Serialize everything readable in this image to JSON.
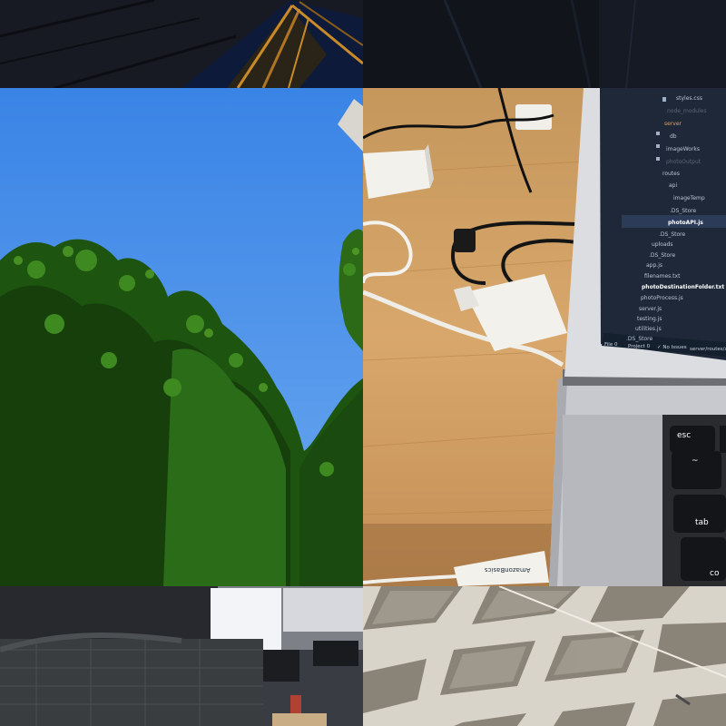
{
  "file_tree": [
    {
      "label": "styles.css",
      "style": "normal"
    },
    {
      "label": "node_modules",
      "style": "dim"
    },
    {
      "label": "server",
      "style": "orange"
    },
    {
      "label": "db",
      "style": "normal"
    },
    {
      "label": "imageWorks",
      "style": "normal"
    },
    {
      "label": "photoOutput",
      "style": "dim"
    },
    {
      "label": "routes",
      "style": "normal"
    },
    {
      "label": "api",
      "style": "normal"
    },
    {
      "label": "imageTemp",
      "style": "normal"
    },
    {
      "label": ".DS_Store",
      "style": "normal"
    },
    {
      "label": "photoAPI.js",
      "style": "sel"
    },
    {
      "label": ".DS_Store",
      "style": "normal"
    },
    {
      "label": "uploads",
      "style": "normal"
    },
    {
      "label": ".DS_Store",
      "style": "normal"
    },
    {
      "label": "app.js",
      "style": "normal"
    },
    {
      "label": "filenames.txt",
      "style": "normal"
    },
    {
      "label": "photoDestinationFolder.txt",
      "style": "sel"
    },
    {
      "label": "photoProcess.js",
      "style": "normal"
    },
    {
      "label": "server.js",
      "style": "normal"
    },
    {
      "label": "testing.js",
      "style": "normal"
    },
    {
      "label": "utilities.js",
      "style": "normal"
    },
    {
      "label": ".DS_Store",
      "style": "normal"
    }
  ],
  "status_bar": {
    "file": "File 0",
    "project": "Project 0",
    "issues": "✓ No Issues",
    "path": "server/routes/a"
  },
  "keys": {
    "esc": "esc",
    "tilde": "~",
    "tab": "tab",
    "cmd": "co"
  },
  "cable_brand": "AmazonBasics",
  "colors": {
    "sky": "#4a90ec",
    "foliage": "#1f5a12",
    "desk": "#d4a468",
    "editor_bg": "#1e2838"
  }
}
